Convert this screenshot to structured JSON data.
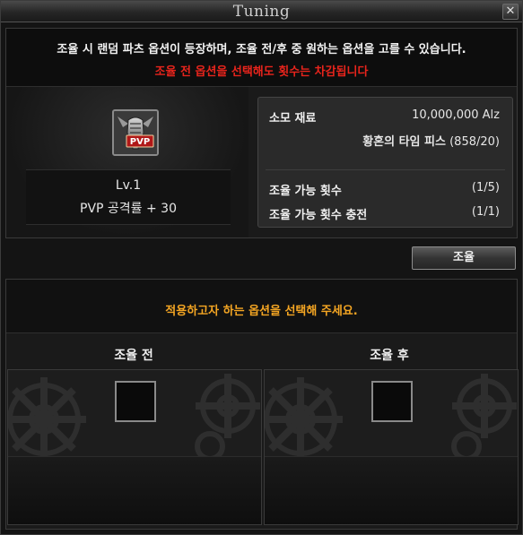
{
  "window": {
    "title": "Tuning",
    "close_glyph": "✕"
  },
  "notice": {
    "line1": "조율 시 랜덤 파츠 옵션이 등장하며, 조율 전/후 중 원하는 옵션을 고를 수 있습니다.",
    "line2": "조율 전 옵션을 선택해도 횟수는 차감됩니다"
  },
  "item": {
    "icon": "pvp-fist-icon",
    "badge": "PVP",
    "level": "Lv.1",
    "stat": "PVP 공격률  + 30"
  },
  "info": {
    "material_label": "소모 재료",
    "material_alz": "10,000,000 Alz",
    "material_item_name": "황혼의 타임 피스",
    "material_item_count": "(858/20)",
    "tune_count_label": "조율 가능 횟수",
    "tune_count_value": "(1/5)",
    "recharge_label": "조율 가능 횟수 충전",
    "recharge_value": "(1/1)"
  },
  "tune_button": {
    "label": "조율"
  },
  "options": {
    "prompt": "적용하고자 하는 옵션을 선택해 주세요.",
    "before_label": "조율 전",
    "after_label": "조율 후"
  },
  "colors": {
    "warning": "#e8241c",
    "prompt": "#f5a623",
    "panel": "#1a1a1a"
  }
}
